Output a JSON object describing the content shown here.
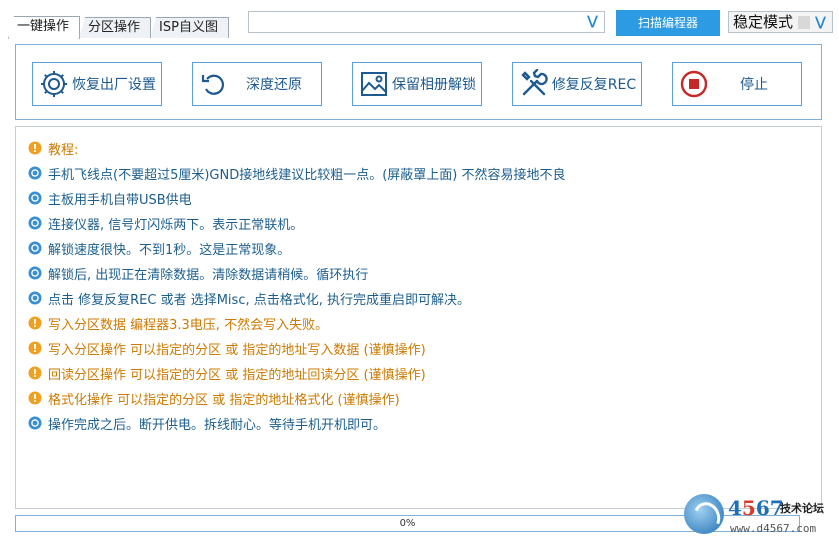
{
  "tabs": [
    {
      "label": "一键操作",
      "active": true
    },
    {
      "label": "分区操作",
      "active": false
    },
    {
      "label": "ISP自义图",
      "active": false
    }
  ],
  "device_combo": {
    "value": ""
  },
  "scan_button": "扫描编程器",
  "mode_select": {
    "value": "稳定模式"
  },
  "actions": [
    {
      "label": "恢复出厂设置",
      "icon": "gear-icon"
    },
    {
      "label": "深度还原",
      "icon": "undo-icon"
    },
    {
      "label": "保留相册解锁",
      "icon": "image-icon"
    },
    {
      "label": "修复反复REC",
      "icon": "tools-icon"
    },
    {
      "label": "停止",
      "icon": "stop-icon"
    }
  ],
  "log": [
    {
      "type": "warn",
      "text": "教程:"
    },
    {
      "type": "info",
      "text": "手机飞线点(不要超过5厘米)GND接地线建议比较粗一点。(屏蔽罩上面) 不然容易接地不良"
    },
    {
      "type": "info",
      "text": "主板用手机自带USB供电"
    },
    {
      "type": "info",
      "text": "连接仪器, 信号灯闪烁两下。表示正常联机。"
    },
    {
      "type": "info",
      "text": "解锁速度很快。不到1秒。这是正常现象。"
    },
    {
      "type": "info",
      "text": "解锁后, 出现正在清除数据。清除数据请稍候。循环执行"
    },
    {
      "type": "info",
      "text": "点击 修复反复REC 或者 选择Misc, 点击格式化, 执行完成重启即可解决。"
    },
    {
      "type": "warn",
      "text": "写入分区数据 编程器3.3电压, 不然会写入失败。"
    },
    {
      "type": "warn",
      "text": "写入分区操作 可以指定的分区 或 指定的地址写入数据 (谨慎操作)"
    },
    {
      "type": "warn",
      "text": "回读分区操作 可以指定的分区 或 指定的地址回读分区 (谨慎操作)"
    },
    {
      "type": "warn",
      "text": "格式化操作 可以指定的分区 或 指定的地址格式化 (谨慎操作)"
    },
    {
      "type": "info",
      "text": "操作完成之后。断开供电。拆线耐心。等待手机开机即可。"
    }
  ],
  "progress": {
    "value": 0,
    "label": "0%"
  },
  "watermark": {
    "brand_4": "4",
    "brand_5": "5",
    "brand_6": "6",
    "brand_7": "7",
    "slogan": "技术论坛",
    "url": "www.d4567.com"
  },
  "colors": {
    "accent": "#2c9be3",
    "info": "#1c5f8e",
    "warn": "#cc7a00"
  }
}
